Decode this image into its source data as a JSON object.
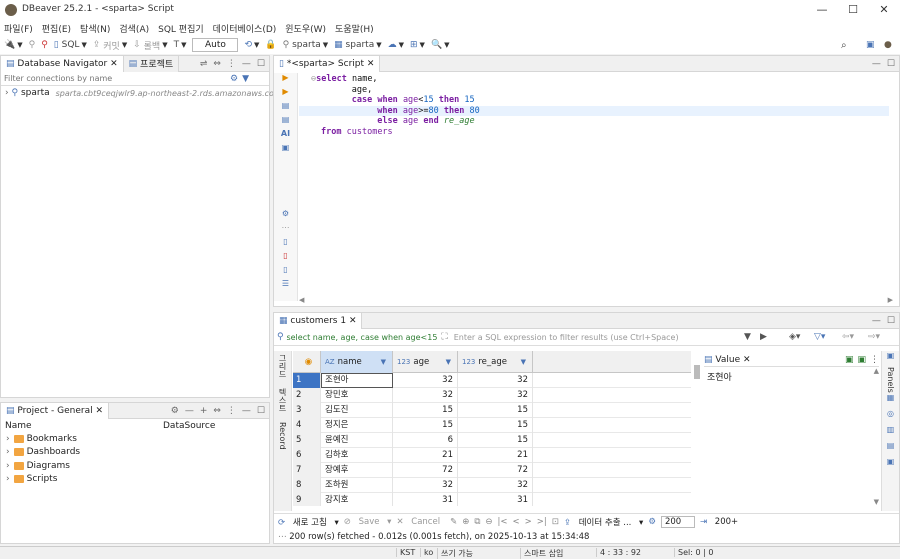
{
  "window": {
    "title": "DBeaver 25.2.1 - <sparta> Script",
    "minimize": "—",
    "maximize": "☐",
    "close": "✕"
  },
  "menu": [
    "파일(F)",
    "편집(E)",
    "탐색(N)",
    "검색(A)",
    "SQL 편집기",
    "데이터베이스(D)",
    "윈도우(W)",
    "도움말(H)"
  ],
  "toolbar": {
    "sql_label": "SQL",
    "commit_label": "커밋",
    "rollback_label": "롤백",
    "tx_mode": "Auto",
    "datasource": "sparta",
    "schema": "sparta"
  },
  "navigator": {
    "tab_label": "Database Navigator",
    "tab2_label": "프로젝트",
    "filter_placeholder": "Filter connections by name",
    "connection_name": "sparta",
    "connection_desc": "sparta.cbt9ceqjwlr9.ap-northeast-2.rds.amazonaws.co..."
  },
  "projects": {
    "tab_label": "Project - General",
    "col_name": "Name",
    "col_datasource": "DataSource",
    "items": [
      "Bookmarks",
      "Dashboards",
      "Diagrams",
      "Scripts"
    ]
  },
  "editor": {
    "tab_label": "*<sparta> Script",
    "gutter_ai": "AI"
  },
  "sql": {
    "l1_kw": "select",
    "l1_rest": " name,",
    "l2": "age,",
    "l3_kw1": "case",
    "l3_kw2": "when",
    "l3_id": "age",
    "l3_op": "<",
    "l3_num1": "15",
    "l3_kw3": "then",
    "l3_num2": "15",
    "l4_kw1": "when",
    "l4_id": "age",
    "l4_op": ">=",
    "l4_num1": "80",
    "l4_kw2": "then",
    "l4_num2": "80",
    "l5_kw1": "else",
    "l5_id": "age",
    "l5_kw2": "end",
    "l5_alias": "re_age",
    "l6_kw": "from",
    "l6_table": "customers"
  },
  "results": {
    "tab_label": "customers 1",
    "filter_query": "select name, age, case when age<15",
    "filter_placeholder": "Enter a SQL expression to filter results (use Ctrl+Space)",
    "vtab_grid": "그리드",
    "vtab_text": "텍스트",
    "vtab_record": "Record",
    "columns": [
      {
        "type": "AZ",
        "name": "name"
      },
      {
        "type": "123",
        "name": "age"
      },
      {
        "type": "123",
        "name": "re_age"
      }
    ],
    "rows": [
      [
        "1",
        "조현아",
        "32",
        "32"
      ],
      [
        "2",
        "장민호",
        "32",
        "32"
      ],
      [
        "3",
        "김도진",
        "15",
        "15"
      ],
      [
        "4",
        "정지은",
        "15",
        "15"
      ],
      [
        "5",
        "윤예진",
        "6",
        "15"
      ],
      [
        "6",
        "김하호",
        "21",
        "21"
      ],
      [
        "7",
        "장예후",
        "72",
        "72"
      ],
      [
        "8",
        "조하원",
        "32",
        "32"
      ],
      [
        "9",
        "강지호",
        "31",
        "31"
      ]
    ],
    "value_panel_tab": "Value",
    "value_panel_content": "조현아",
    "panels_label": "Panels",
    "actions": {
      "refresh": "새로 고침",
      "save": "Save",
      "cancel": "Cancel",
      "export": "데이터 추출 ...",
      "fetch_size": "200",
      "fetch_more": "200+"
    },
    "status": "200 row(s) fetched - 0.012s (0.001s fetch), on 2025-10-13 at 15:34:48"
  },
  "statusbar": {
    "tz": "KST",
    "lang": "ko",
    "write": "쓰기 가능",
    "insert": "스마트 삽입",
    "pos": "4 : 33 : 92",
    "sel": "Sel: 0 | 0"
  }
}
